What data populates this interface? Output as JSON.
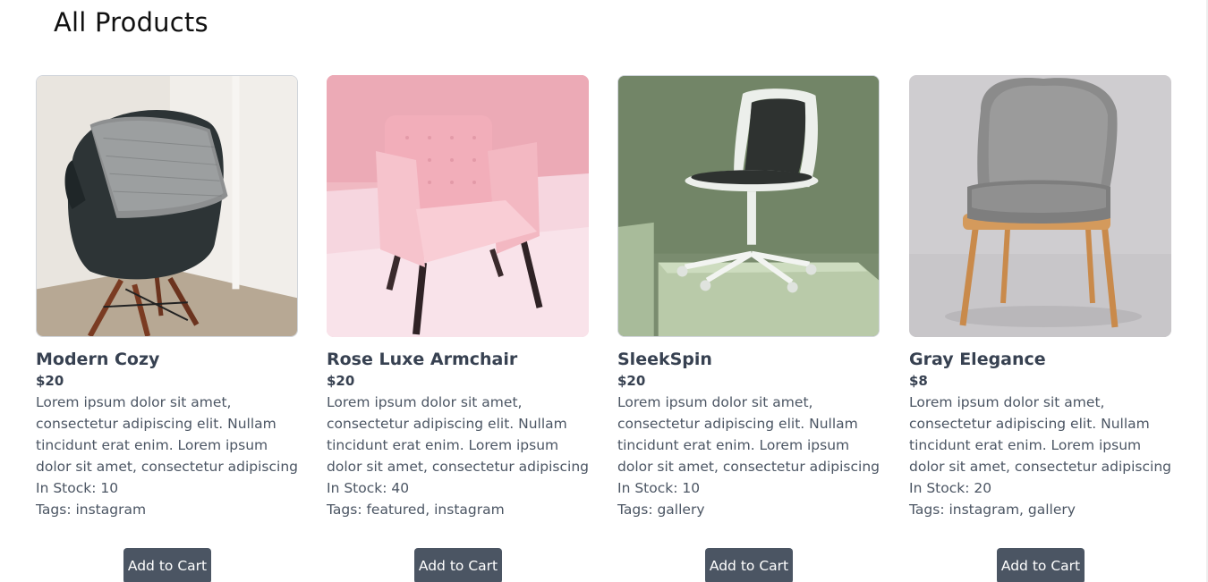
{
  "page": {
    "title": "All Products"
  },
  "products": [
    {
      "name": "Modern Cozy",
      "price": "$20",
      "description": "Lorem ipsum dolor sit amet, consectetur adipiscing elit. Nullam tincidunt erat enim. Lorem ipsum dolor sit amet, consectetur adipiscing",
      "stock": "In Stock: 10",
      "tags": "Tags: instagram",
      "button_label": "Add to Cart",
      "image_icon": "black-shell-chair-with-gray-pillow"
    },
    {
      "name": "Rose Luxe Armchair",
      "price": "$20",
      "description": "Lorem ipsum dolor sit amet, consectetur adipiscing elit. Nullam tincidunt erat enim. Lorem ipsum dolor sit amet, consectetur adipiscing",
      "stock": "In Stock: 40",
      "tags": "Tags: featured, instagram",
      "button_label": "Add to Cart",
      "image_icon": "pink-tufted-armchair"
    },
    {
      "name": "SleekSpin",
      "price": "$20",
      "description": "Lorem ipsum dolor sit amet, consectetur adipiscing elit. Nullam tincidunt erat enim. Lorem ipsum dolor sit amet, consectetur adipiscing",
      "stock": "In Stock: 10",
      "tags": "Tags: gallery",
      "button_label": "Add to Cart",
      "image_icon": "white-swivel-desk-chair"
    },
    {
      "name": "Gray Elegance",
      "price": "$8",
      "description": "Lorem ipsum dolor sit amet, consectetur adipiscing elit. Nullam tincidunt erat enim. Lorem ipsum dolor sit amet, consectetur adipiscing",
      "stock": "In Stock: 20",
      "tags": "Tags: instagram, gallery",
      "button_label": "Add to Cart",
      "image_icon": "gray-upholstered-wooden-chair"
    }
  ],
  "colors": {
    "button_bg": "#4b5563",
    "button_text": "#ffffff",
    "heading_text": "#111111",
    "body_text": "#4b5563"
  }
}
